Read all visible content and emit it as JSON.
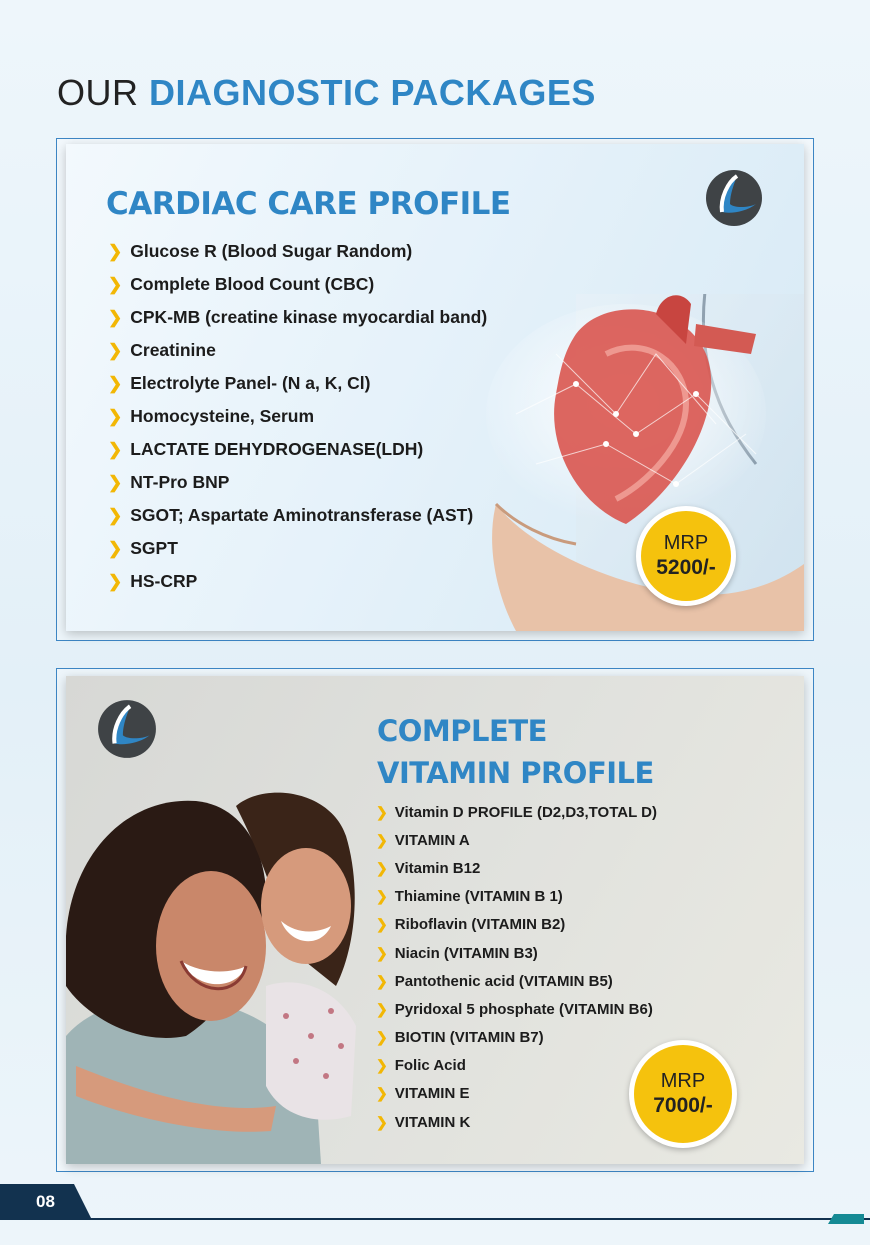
{
  "heading": {
    "light": "OUR ",
    "bold": "DIAGNOSTIC PACKAGES"
  },
  "packages": [
    {
      "title": "CARDIAC CARE PROFILE",
      "tests": [
        "Glucose R (Blood Sugar Random)",
        "Complete Blood Count (CBC)",
        "CPK-MB (creatine kinase myocardial band)",
        "Creatinine",
        "Electrolyte Panel- (N a, K, Cl)",
        "Homocysteine, Serum",
        "LACTATE DEHYDROGENASE(LDH)",
        "NT-Pro BNP",
        "SGOT; Aspartate Aminotransferase (AST)",
        "SGPT",
        "HS-CRP"
      ],
      "mrp_label": "MRP",
      "price": "5200/-"
    },
    {
      "title_line1": "COMPLETE",
      "title_line2": "VITAMIN PROFILE",
      "tests": [
        "Vitamin D PROFILE (D2,D3,TOTAL D)",
        "VITAMIN A",
        "Vitamin B12",
        "Thiamine (VITAMIN B 1)",
        "Riboflavin (VITAMIN B2)",
        "Niacin (VITAMIN B3)",
        "Pantothenic acid (VITAMIN B5)",
        "Pyridoxal 5 phosphate (VITAMIN B6)",
        "BIOTIN (VITAMIN B7)",
        "Folic Acid",
        "VITAMIN E",
        "VITAMIN K"
      ],
      "mrp_label": "MRP",
      "price": "7000/-"
    }
  ],
  "footer": {
    "page_number": "08"
  },
  "colors": {
    "accent_blue": "#2f86c5",
    "badge_yellow": "#f5c20d",
    "bullet_yellow": "#f2b705",
    "footer_navy": "#12324f",
    "footer_teal": "#158a94"
  },
  "icons": {
    "bullet": "chevron-right-icon",
    "logo": "brand-logo-icon"
  }
}
